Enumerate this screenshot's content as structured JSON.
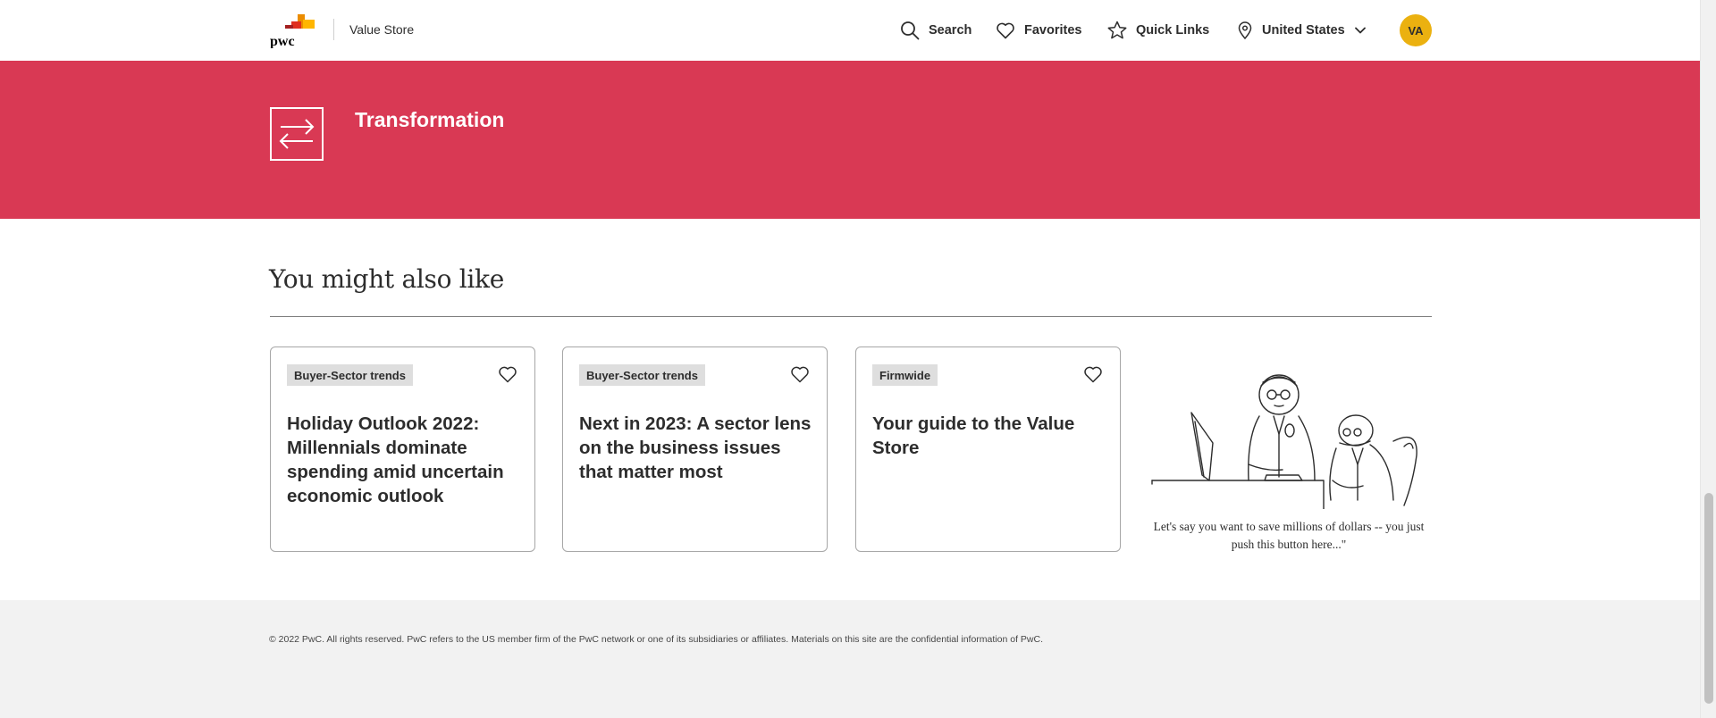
{
  "header": {
    "brand_name": "Value Store",
    "nav": {
      "search": "Search",
      "favorites": "Favorites",
      "quick_links": "Quick Links",
      "region": "United States"
    },
    "avatar_initials": "VA"
  },
  "hero": {
    "title": "Transformation",
    "icon": "transfer-arrows-icon"
  },
  "related": {
    "title": "You might also like",
    "cards": [
      {
        "tag": "Buyer-Sector trends",
        "title": "Holiday Outlook 2022: Millennials dominate spending amid uncertain economic outlook"
      },
      {
        "tag": "Buyer-Sector trends",
        "title": "Next in 2023: A sector lens on the business issues that matter most"
      },
      {
        "tag": "Firmwide",
        "title": "Your guide to the Value Store"
      }
    ],
    "cartoon_caption": "Let's say you want to save millions of dollars -- you just push this button here...\""
  },
  "footer": {
    "copyright": "© 2022 PwC. All rights reserved. PwC refers to the US member firm of the PwC network or one of its subsidiaries or affiliates. Materials on this site are the confidential information of PwC."
  },
  "colors": {
    "hero_bg": "#d93954",
    "avatar_bg": "#ebb110",
    "footer_bg": "#f2f2f2",
    "logo_orange": "#e0301e",
    "logo_amber": "#eb8c00",
    "logo_yellow": "#ffb600"
  }
}
